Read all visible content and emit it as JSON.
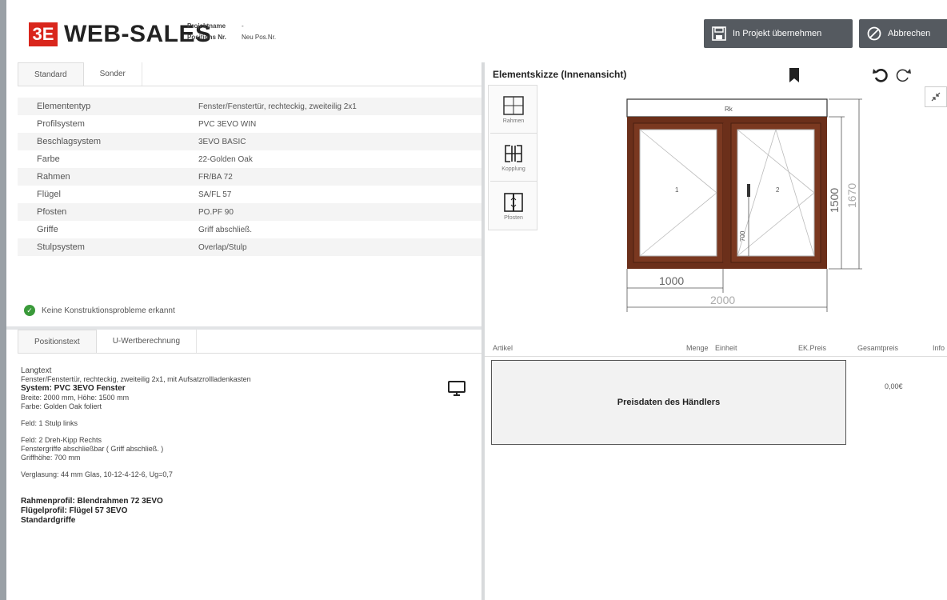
{
  "header": {
    "logo_text": "3E",
    "brand": "WEB-SALES",
    "project_label": "Projektname",
    "project_value": "-",
    "position_label": "Positions Nr.",
    "position_value": "Neu Pos.Nr.",
    "save_button": "In Projekt übernehmen",
    "cancel_button": "Abbrechen"
  },
  "left_top": {
    "tabs": [
      "Standard",
      "Sonder"
    ],
    "properties": [
      {
        "key": "Elemententyp",
        "value": "Fenster/Fenstertür, rechteckig, zweiteilig 2x1"
      },
      {
        "key": "Profilsystem",
        "value": "PVC 3EVO WIN"
      },
      {
        "key": "Beschlagsystem",
        "value": "3EVO BASIC"
      },
      {
        "key": "Farbe",
        "value": "22-Golden Oak"
      },
      {
        "key": "Rahmen",
        "value": "FR/BA 72"
      },
      {
        "key": "Flügel",
        "value": "SA/FL 57"
      },
      {
        "key": "Pfosten",
        "value": "PO.PF 90"
      },
      {
        "key": "Griffe",
        "value": "Griff abschließ."
      },
      {
        "key": "Stulpsystem",
        "value": "Overlap/Stulp"
      }
    ],
    "status": "Keine Konstruktionsprobleme erkannt"
  },
  "left_bottom": {
    "tabs": [
      "Positionstext",
      "U-Wertberechnung"
    ],
    "heading": "Langtext",
    "lines1": [
      "Fenster/Fenstertür, rechteckig, zweiteilig 2x1, mit Aufsatzrollladenkasten",
      "System: PVC 3EVO Fenster",
      "Breite: 2000 mm, Höhe: 1500 mm",
      "Farbe: Golden Oak foliert"
    ],
    "field1": "Feld: 1 Stulp links",
    "field2": [
      "Feld: 2 Dreh-Kipp Rechts",
      "Fenstergriffe abschließbar ( Griff abschließ. )",
      "Griffhöhe: 700 mm"
    ],
    "glazing": "Verglasung: 44 mm Glas, 10-12-4-12-6, Ug=0,7",
    "bold_lines": [
      "Rahmenprofil: Blendrahmen 72 3EVO",
      "Flügelprofil: Flügel 57 3EVO",
      "Standardgriffe"
    ]
  },
  "sketch": {
    "title": "Elementskizze (Innenansicht)",
    "tools": [
      "Rahmen",
      "Kopplung",
      "Pfosten"
    ],
    "top_box_label": "Rk",
    "left_pane_label": "1",
    "right_pane_label": "2",
    "handle_height_label": "700",
    "dim_width_pane": "1000",
    "dim_width_total": "2000",
    "dim_height_inner": "1500",
    "dim_height_total": "1670"
  },
  "price_grid": {
    "columns": [
      "Artikel",
      "Menge",
      "Einheit",
      "EK.Preis",
      "Gesamtpreis",
      "Info"
    ],
    "dealer_price_label": "Preisdaten des Händlers",
    "total_value": "0,00€"
  },
  "colors": {
    "frame": "#6b2f1a",
    "logo": "#d9261c",
    "button_dark": "#555a60"
  }
}
